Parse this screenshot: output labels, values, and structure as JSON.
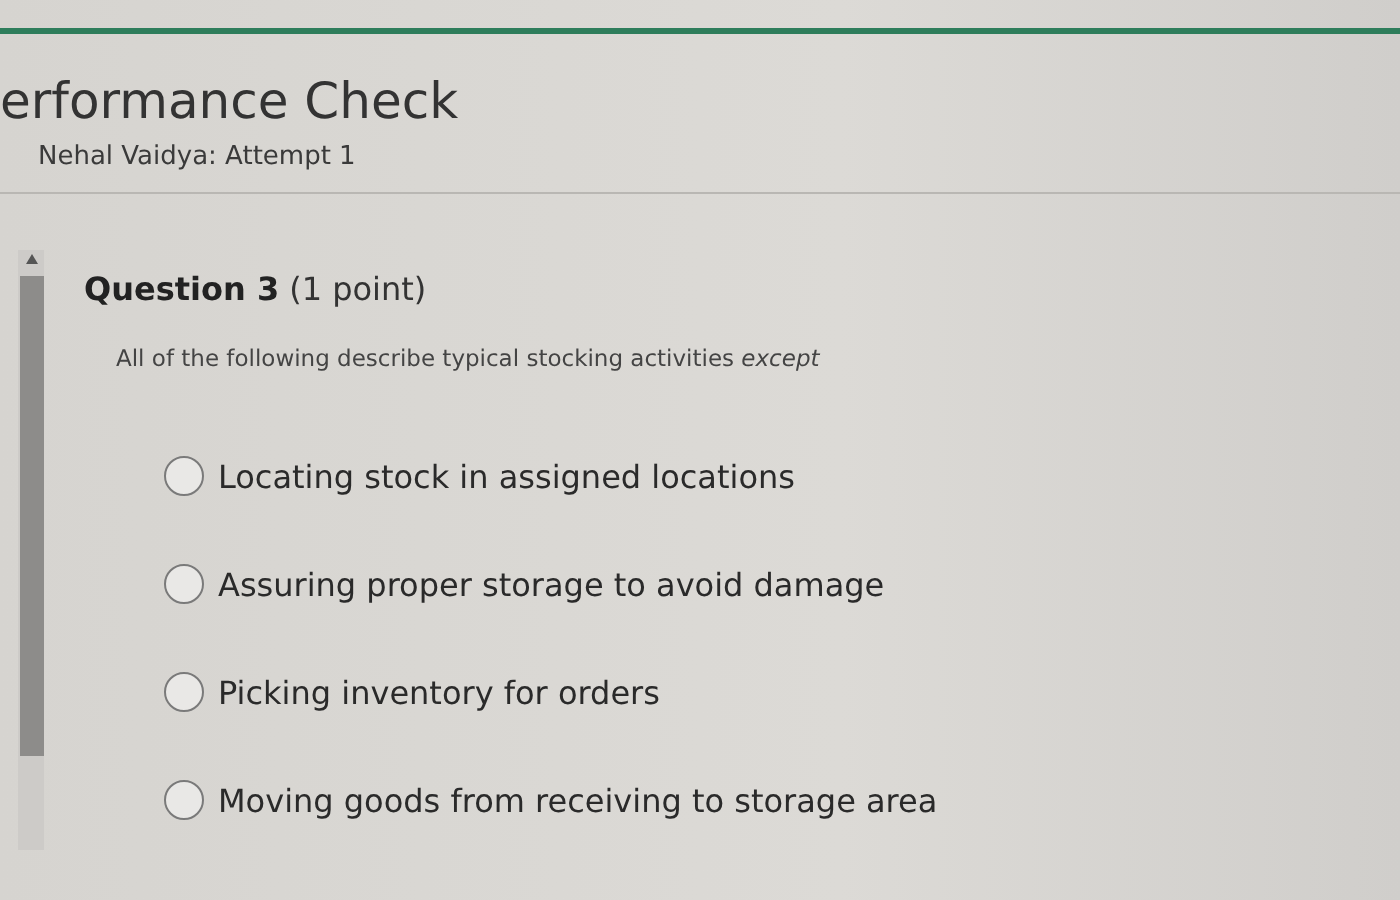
{
  "header": {
    "title": "erformance Check",
    "subtitle": "Nehal Vaidya: Attempt 1"
  },
  "question": {
    "number": "Question 3",
    "points": "(1 point)",
    "prompt": "All of the following describe typical stocking activities *except*",
    "options": [
      {
        "label": "Locating stock in assigned locations",
        "selected": false
      },
      {
        "label": "Assuring proper storage to avoid damage",
        "selected": false
      },
      {
        "label": "Picking inventory for orders",
        "selected": false
      },
      {
        "label": "Moving goods from receiving to storage area",
        "selected": false
      }
    ]
  }
}
